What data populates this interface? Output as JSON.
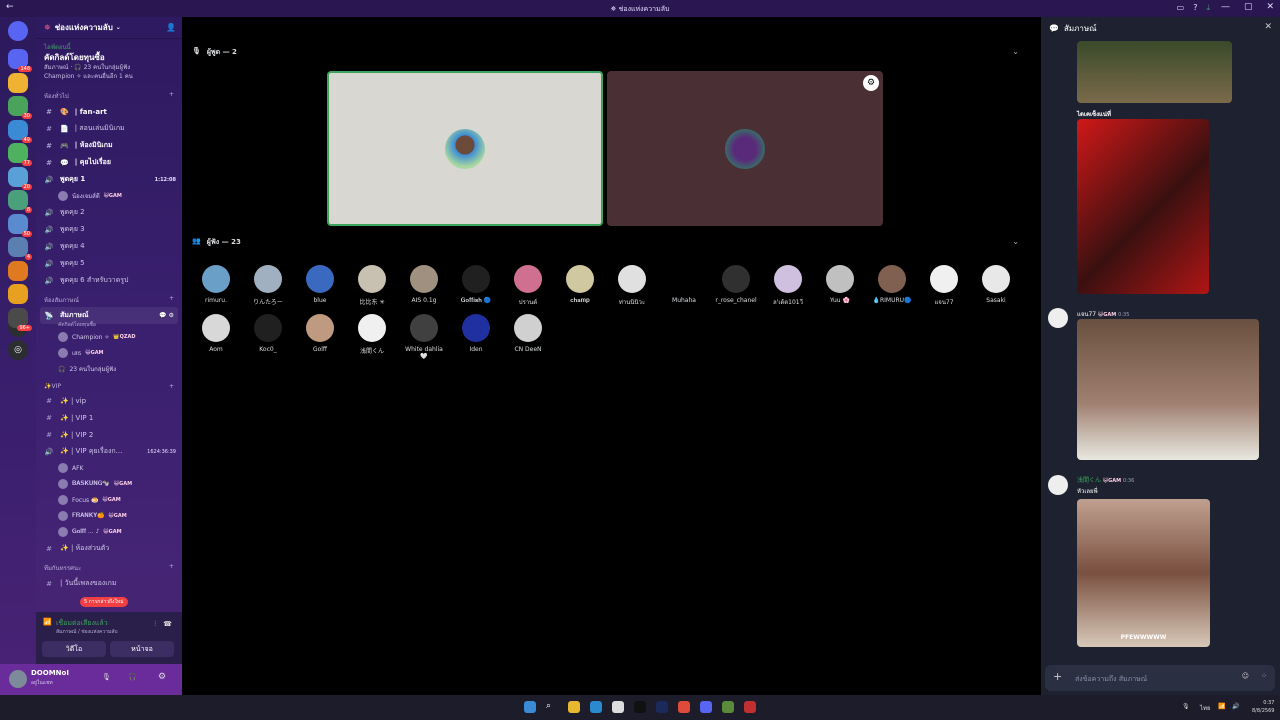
{
  "titlebar": {
    "title": "✵ ช่องแห่งความลับ",
    "back": "←",
    "icons": [
      "▭",
      "?",
      "⤓"
    ],
    "win": [
      "—",
      "▢",
      "✕"
    ]
  },
  "guilds": [
    {
      "color": "#5865f2",
      "badge": "148"
    },
    {
      "color": "#f0b232",
      "badge": ""
    },
    {
      "color": "#4aa35a",
      "badge": "30"
    },
    {
      "color": "#3a8ad6",
      "badge": "49"
    },
    {
      "color": "#4fb060",
      "badge": "77"
    },
    {
      "color": "#5aa0d8",
      "badge": "20"
    },
    {
      "color": "#4aa07a",
      "badge": "8"
    },
    {
      "color": "#5a8bd0",
      "badge": "50"
    },
    {
      "color": "#5a7fb0",
      "badge": "4"
    },
    {
      "color": "#e07a20",
      "badge": ""
    },
    {
      "color": "#e8a020",
      "badge": ""
    },
    {
      "color": "#4a4a4a",
      "badge": "96+"
    }
  ],
  "server": {
    "name": "ช่องแห่งความลับ",
    "event": {
      "status": "ไลฟ์ตอนนี้",
      "title": "คัดกิลด์โดยทุนซื้อ",
      "line1": "สัมภาษณ์ · 🎧 23 คนในกลุ่มผู้ฟัง",
      "line2": "Champion ✧ และคนอื่นอีก 1 คน"
    },
    "cat_general": "ห้องทั่วไป",
    "text_channels": [
      {
        "icon": "🎨",
        "name": "| fan-art",
        "bold": true
      },
      {
        "icon": "📄",
        "name": "| สอนเล่นมินิเกม",
        "bold": false
      },
      {
        "icon": "🎮",
        "name": "| ห้องมินิเกม",
        "bold": true
      },
      {
        "icon": "💬",
        "name": "| คุยไปเรื่อย",
        "bold": true
      }
    ],
    "voice1": {
      "name": "พูดคุย 1",
      "time": "1:12:08",
      "member": "น้องเจมส์ดี",
      "tag": "😺GAM"
    },
    "voice_channels": [
      "พูดคุย 2",
      "พูดคุย 3",
      "พูดคุย 4",
      "พูดคุย 5",
      "พูดคุย 6 สำหรับวาดรูป"
    ],
    "cat_stage": "ห้องสัมภาษณ์",
    "stage": {
      "name": "สัมภาษณ์",
      "sub": "คัดกิลด์โดยทุนซื้อ"
    },
    "stage_members": [
      {
        "name": "Champion ✧",
        "tag": "👑QZAD"
      },
      {
        "name": "เสธ",
        "tag": "😺GAM"
      }
    ],
    "stage_listeners": "23 คนในกลุ่มผู้ฟัง",
    "cat_vip": "✨VIP",
    "vip_channels": [
      "✨ | vip",
      "✨ | VIP 1",
      "✨ | VIP 2"
    ],
    "vip_voice": {
      "name": "✨ | VIP คุยเรื่องก...",
      "time": "1624:36:39"
    },
    "vip_members": [
      {
        "name": "AFK",
        "tag": ""
      },
      {
        "name": "𝐁𝐀𝐒𝐊𝐔𝐍𝐆🐄",
        "tag": "😺GAM"
      },
      {
        "name": "Focus 🍮",
        "tag": "😺GAM"
      },
      {
        "name": "𝐅𝐑𝐀𝐍𝐊𝐘🍊",
        "tag": "😺GAM"
      },
      {
        "name": "𝐆𝐨𝐥𝐟𝐟 ... ♪",
        "tag": "😺GAM"
      }
    ],
    "private_channel": "✨ | ห้องส่วนตัว",
    "cat_team": "ทีมกันทรรศนะ",
    "team_channel": "| วันนี้เพลงของเกม",
    "pill": "5 การกล่าวถึงใหม่"
  },
  "voice_panel": {
    "status": "เชื่อมต่อเสียงแล้ว",
    "sub": "สัมภาษณ์ / ช่องแห่งความลับ",
    "video": "วิดีโอ",
    "screen": "หน้าจอ"
  },
  "user": {
    "name": "DOOMNoI",
    "status": "อยู่ในแชท"
  },
  "stage": {
    "speakers_label": "ผู้พูด — 2",
    "listeners_label": "ผู้ฟัง — 23",
    "listeners": [
      {
        "name": "rimuru.",
        "color": "#6aa0c8"
      },
      {
        "name": "りんたろー",
        "color": "#a0b0c0"
      },
      {
        "name": "blue",
        "color": "#3a6ac0"
      },
      {
        "name": "比比东 ✳",
        "color": "#c8c0b0"
      },
      {
        "name": "AIS 0.1g",
        "color": "#a09080"
      },
      {
        "name": "𝐆𝐨𝐟𝐟𝐢𝐬𝐡 🔵",
        "color": "#202020"
      },
      {
        "name": "ปรานต์",
        "color": "#d07090"
      },
      {
        "name": "𝐜𝐡𝐚𝐦𝐩",
        "color": "#d0c8a0"
      },
      {
        "name": "ท่านนินิวะ",
        "color": "#e0e0e0"
      },
      {
        "name": "Muhaha",
        "color": "#000000"
      },
      {
        "name": "r_rose_chanel",
        "color": "#303030"
      },
      {
        "name": "ล'เด้ต101วี",
        "color": "#d0c0e0"
      },
      {
        "name": "Yuu 🌸",
        "color": "#c0c0c0"
      },
      {
        "name": "💧RIMURU🔵",
        "color": "#806050"
      },
      {
        "name": "แจน77",
        "color": "#f0f0f0"
      },
      {
        "name": "Sasaki",
        "color": "#e8e8e8"
      },
      {
        "name": "Aom",
        "color": "#d8d8d8"
      },
      {
        "name": "Koc0_",
        "color": "#202020"
      },
      {
        "name": "Golff",
        "color": "#c09a80"
      },
      {
        "name": "浅間くん",
        "color": "#f0f0f0"
      },
      {
        "name": "White dahlia 🤍",
        "color": "#404040"
      },
      {
        "name": "Iden",
        "color": "#2030a0"
      },
      {
        "name": "CN DeeN",
        "color": "#d0d0d0"
      }
    ]
  },
  "chat": {
    "title": "สัมภาษณ์",
    "msg1_text": "ไดเคเซ็งแน่ที่",
    "msg2_name": "แจน77",
    "msg2_tag": "😺GAM",
    "msg2_time": "0:35",
    "msg3_name": "浅間くん",
    "msg3_tag": "😺GAM",
    "msg3_time": "0:36",
    "msg3_text": "หัวเลยพี่",
    "gif_caption": "PFEWWWWW",
    "input_placeholder": "ส่งข้อความถึง สัมภาษณ์"
  },
  "taskbar": {
    "lang": "ไทย",
    "time": "0:37",
    "date": "8/8/2569"
  }
}
